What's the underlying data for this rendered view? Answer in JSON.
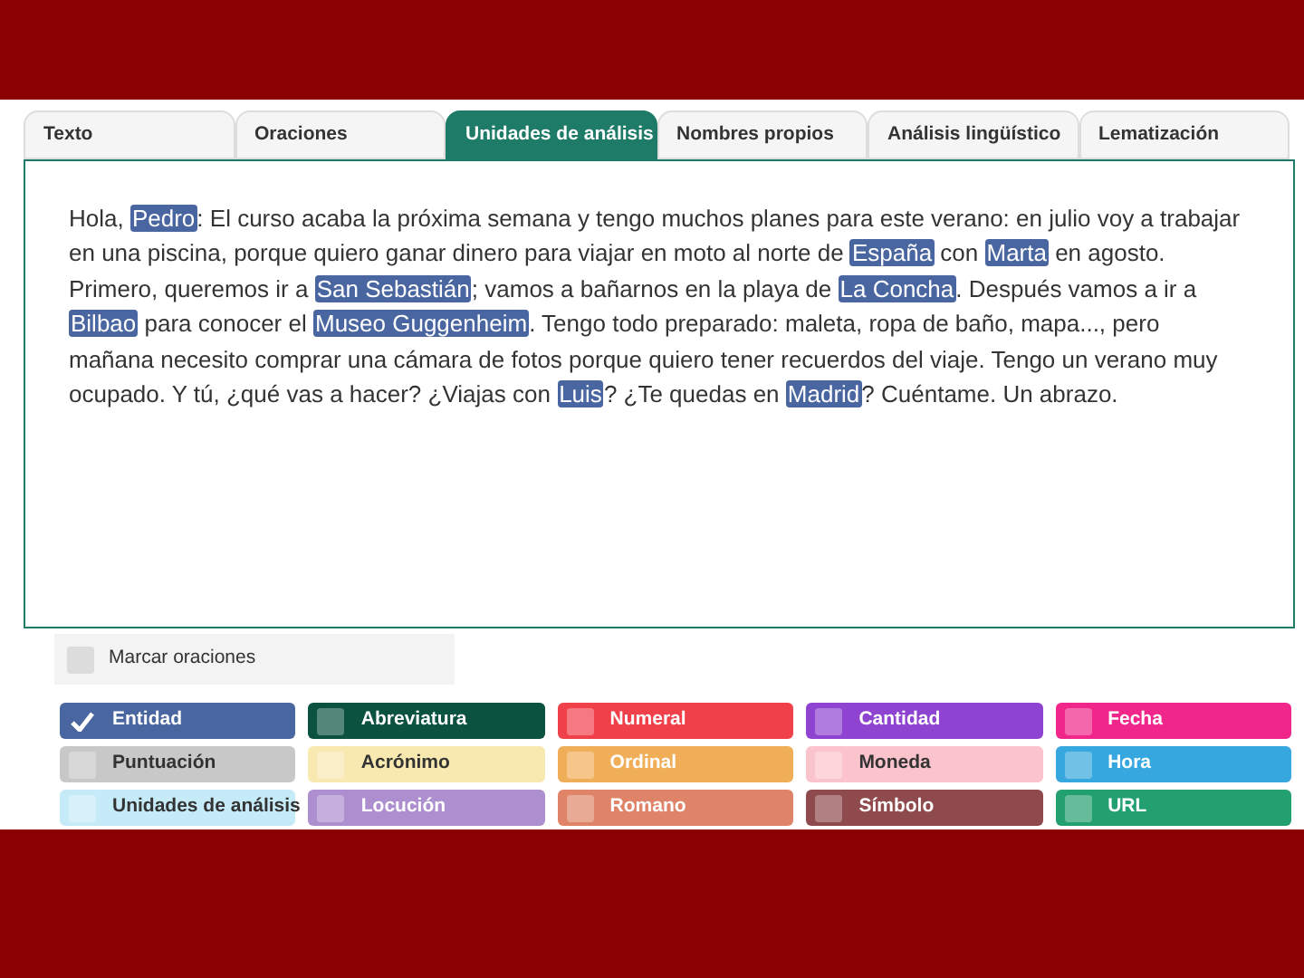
{
  "tabs": [
    {
      "label": "Texto",
      "selected": false
    },
    {
      "label": "Oraciones",
      "selected": false
    },
    {
      "label": "Unidades de análisis",
      "selected": true
    },
    {
      "label": "Nombres propios",
      "selected": false
    },
    {
      "label": "Análisis lingüístico",
      "selected": false
    },
    {
      "label": "Lematización",
      "selected": false
    }
  ],
  "text_segments": [
    {
      "text": "Hola, ",
      "entity": false
    },
    {
      "text": "Pedro",
      "entity": true
    },
    {
      "text": ": El curso acaba la próxima semana y tengo muchos planes para este verano: en julio voy a trabajar en una piscina, porque quiero ganar dinero para viajar en moto al norte de ",
      "entity": false
    },
    {
      "text": "España",
      "entity": true
    },
    {
      "text": " con ",
      "entity": false
    },
    {
      "text": "Marta",
      "entity": true
    },
    {
      "text": " en agosto. Primero, queremos ir a ",
      "entity": false
    },
    {
      "text": "San Sebastián",
      "entity": true
    },
    {
      "text": "; vamos a bañarnos en la playa de ",
      "entity": false
    },
    {
      "text": "La Concha",
      "entity": true
    },
    {
      "text": ". Después vamos a ir a ",
      "entity": false
    },
    {
      "text": "Bilbao",
      "entity": true
    },
    {
      "text": " para conocer el ",
      "entity": false
    },
    {
      "text": "Museo Guggenheim",
      "entity": true
    },
    {
      "text": ". Tengo todo preparado: maleta, ropa de baño, mapa..., pero mañana necesito comprar una cámara de fotos porque quiero tener recuerdos del viaje. Tengo un verano muy ocupado. Y tú, ¿qué vas a hacer? ¿Viajas con ",
      "entity": false
    },
    {
      "text": "Luis",
      "entity": true
    },
    {
      "text": "? ¿Te quedas en ",
      "entity": false
    },
    {
      "text": "Madrid",
      "entity": true
    },
    {
      "text": "? Cuéntame. Un abrazo.",
      "entity": false
    }
  ],
  "mark_sentences": {
    "label": "Marcar oraciones",
    "checked": false
  },
  "categories": [
    {
      "label": "Entidad",
      "color": "#4a66a0",
      "checked": true
    },
    {
      "label": "Abreviatura",
      "color": "#0b5240",
      "checked": false
    },
    {
      "label": "Numeral",
      "color": "#f0404a",
      "checked": false
    },
    {
      "label": "Cantidad",
      "color": "#8e44d0",
      "checked": false
    },
    {
      "label": "Fecha",
      "color": "#f0268a",
      "checked": false
    },
    {
      "label": "Puntuación",
      "color": "#c8c8c8",
      "checked": false
    },
    {
      "label": "Acrónimo",
      "color": "#f8e9b0",
      "checked": false
    },
    {
      "label": "Ordinal",
      "color": "#f0ae58",
      "checked": false
    },
    {
      "label": "Moneda",
      "color": "#fbc4cc",
      "checked": false
    },
    {
      "label": "Hora",
      "color": "#36a8df",
      "checked": false
    },
    {
      "label": "Unidades de análisis",
      "color": "#c6ebf8",
      "checked": false
    },
    {
      "label": "Locución",
      "color": "#ad8fcf",
      "checked": false
    },
    {
      "label": "Romano",
      "color": "#df8468",
      "checked": false
    },
    {
      "label": "Símbolo",
      "color": "#8e4a4c",
      "checked": false
    },
    {
      "label": "URL",
      "color": "#22a070",
      "checked": false
    }
  ]
}
